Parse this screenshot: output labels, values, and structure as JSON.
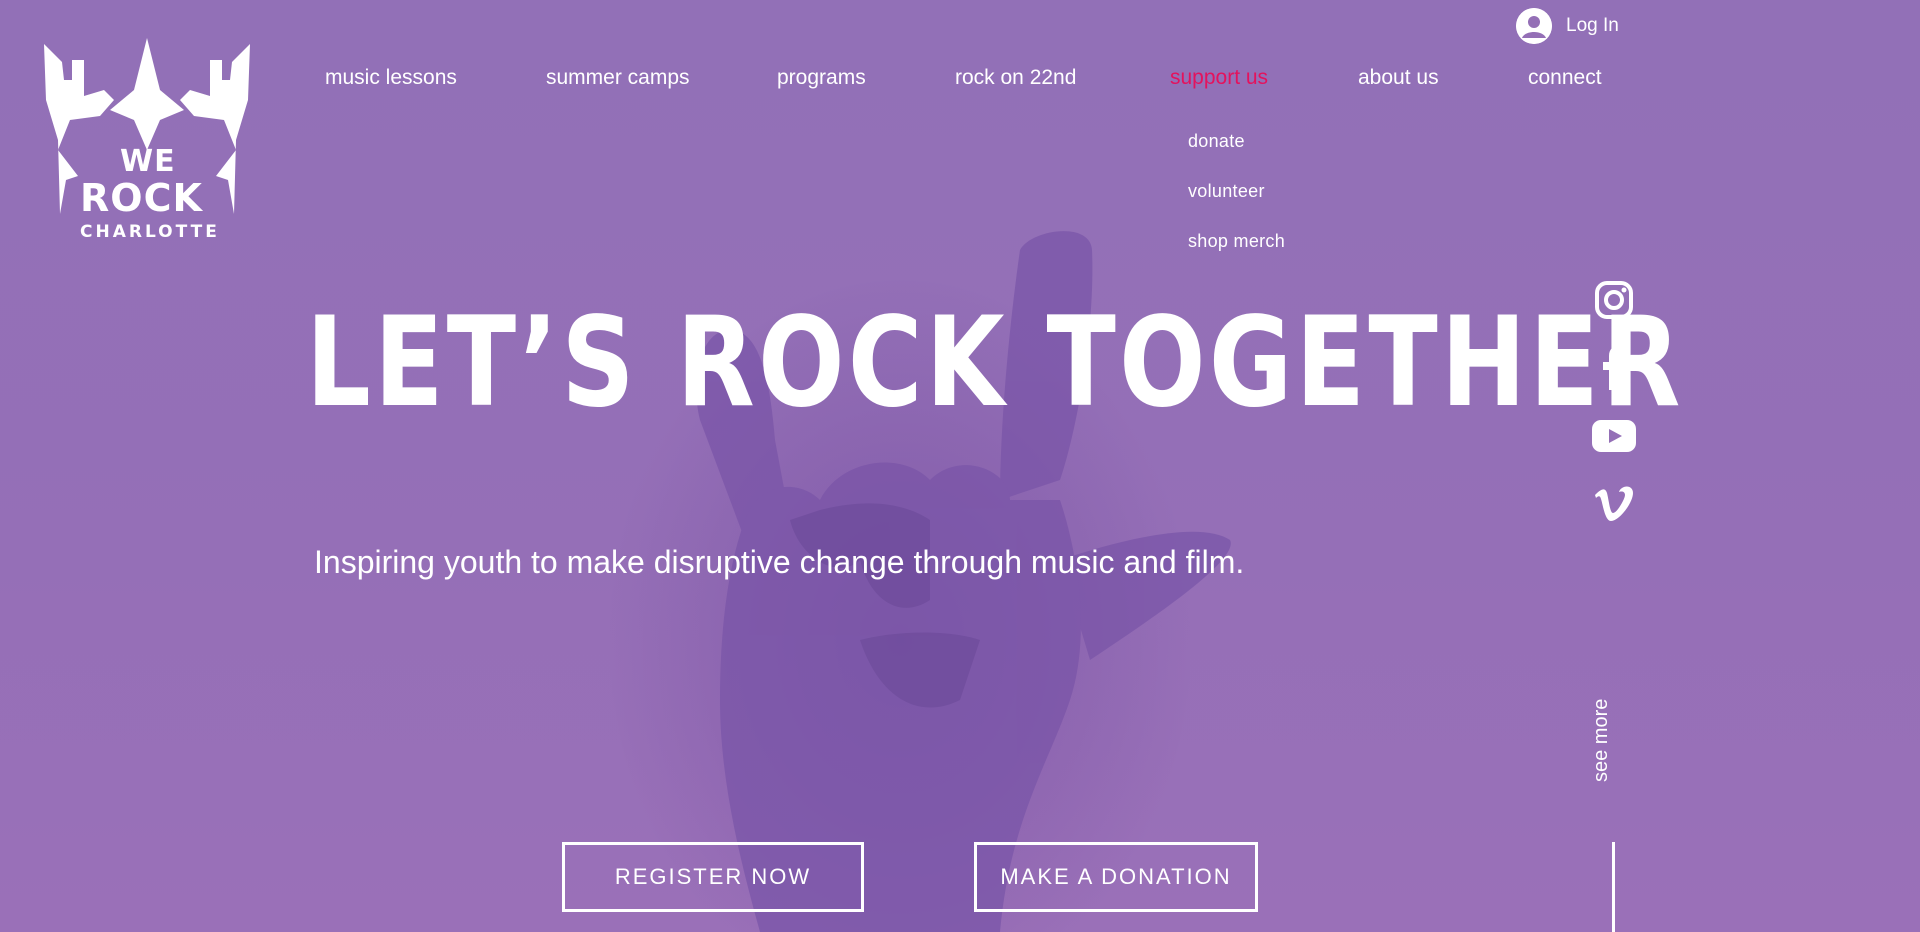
{
  "brand": {
    "logo_we": "WE",
    "logo_rock": "ROCK",
    "logo_city": "CHARLOTTE"
  },
  "header": {
    "login_label": "Log In"
  },
  "nav": {
    "items": [
      {
        "label": "music lessons"
      },
      {
        "label": "summer camps"
      },
      {
        "label": "programs"
      },
      {
        "label": "rock on 22nd"
      },
      {
        "label": "support us",
        "active": true
      },
      {
        "label": "about us"
      },
      {
        "label": "connect"
      }
    ],
    "dropdown": [
      {
        "label": "donate"
      },
      {
        "label": "volunteer"
      },
      {
        "label": "shop merch"
      }
    ]
  },
  "hero": {
    "headline": "LET’S ROCK TOGETHER",
    "tagline": "Inspiring youth to make disruptive change through music and film.",
    "register_label": "REGISTER NOW",
    "donate_label": "MAKE A DONATION",
    "see_more_label": "see more"
  },
  "social": {
    "icons": [
      "instagram-icon",
      "facebook-icon",
      "youtube-icon",
      "vimeo-icon"
    ]
  },
  "colors": {
    "background": "#946fb6",
    "accent": "#e4125d",
    "text": "#ffffff"
  }
}
